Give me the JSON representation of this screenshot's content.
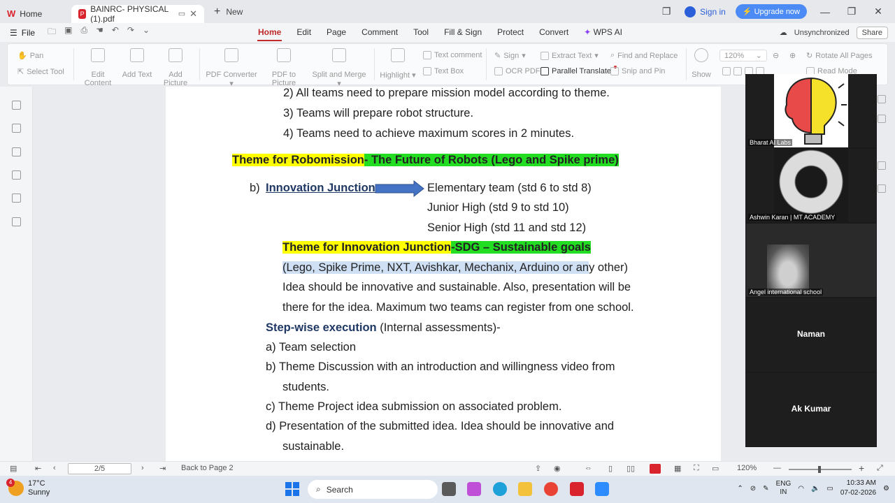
{
  "tabs": {
    "home_label": "Home",
    "active_label": "BAINRC-  PHYSICAL (1).pdf",
    "new_label": "New"
  },
  "top_right": {
    "signin": "Sign in",
    "upgrade": "Upgrade now"
  },
  "menubar": {
    "file": "File",
    "menus": [
      "Home",
      "Edit",
      "Page",
      "Comment",
      "Tool",
      "Fill & Sign",
      "Protect",
      "Convert",
      "WPS AI"
    ],
    "sync": "Unsynchronized",
    "share": "Share"
  },
  "ribbon": {
    "pan": "Pan",
    "select_tool": "Select Tool",
    "edit_content": "Edit Content",
    "add_text": "Add Text",
    "add_picture": "Add Picture",
    "pdf_converter": "PDF Converter",
    "pdf_to_picture": "PDF to Picture",
    "split_merge": "Split and Merge",
    "highlight": "Highlight",
    "text_comment": "Text comment",
    "text_box": "Text Box",
    "sign": "Sign",
    "ocr_pdf": "OCR PDF",
    "extract_text": "Extract Text",
    "parallel_translate": "Parallel Translate",
    "find_replace": "Find and Replace",
    "snip_pin": "Snip and Pin",
    "show": "Show",
    "zoom": "120%",
    "rotate_all": "Rotate All Pages",
    "read_mode": "Read Mode"
  },
  "document": {
    "line_2": "2)  All teams need to prepare mission model according to theme.",
    "line_3": "3)  Teams will prepare robot structure.",
    "line_4": "4)  Teams need to achieve maximum scores in 2 minutes.",
    "robo_theme_yellow": "Theme for Robomission",
    "robo_theme_green": "- The Future of Robots (Lego and Spike prime)",
    "b_label": "b)",
    "innovation_junction": "Innovation Junction",
    "elementary": "Elementary team (std 6 to std 8)",
    "junior": "Junior High (std 9 to std 10)",
    "senior": "Senior High (std 11 and std 12)",
    "ij_theme_yellow": "Theme for Innovation Junction",
    "ij_theme_green": "-SDG – Sustainable goals",
    "platforms_selected": "(Lego, Spike Prime, NXT, Avishkar, Mechanix, Arduino or an",
    "platforms_rest": "y other)",
    "idea_line1": "Idea should be innovative and sustainable. Also, presentation will be",
    "idea_line2": "there for the idea. Maximum two teams can register from one school.",
    "step_bold": "Step-wise execution",
    "step_rest": " (Internal assessments)-",
    "a_item": "a)  Team selection",
    "b_item_1": "b)  Theme Discussion with an introduction and willingness video from",
    "b_item_2": "students.",
    "c_item": "c)  Theme Project idea submission on associated problem.",
    "d_item_1": "d)  Presentation of the submitted idea. Idea should be innovative and",
    "d_item_2": "sustainable."
  },
  "video": {
    "tile1": "Bharat AI Labs",
    "tile2": "Ashwin Karan | MT ACADEMY",
    "tile3": "Angel international school",
    "tile4": "Naman",
    "tile5": "Ak Kumar"
  },
  "statusbar": {
    "page": "2/5",
    "back": "Back to Page 2",
    "zoom": "120%"
  },
  "taskbar": {
    "temp": "17°C",
    "weather": "Sunny",
    "badge": "4",
    "search": "Search",
    "lang1": "ENG",
    "lang2": "IN",
    "time": "10:33 AM",
    "date": "07-02-2026"
  },
  "colors": {
    "accent_red": "#c12a2a",
    "highlight_yellow": "#ffff00",
    "highlight_green": "#22dd22",
    "upgrade_blue": "#4c8bf5"
  }
}
